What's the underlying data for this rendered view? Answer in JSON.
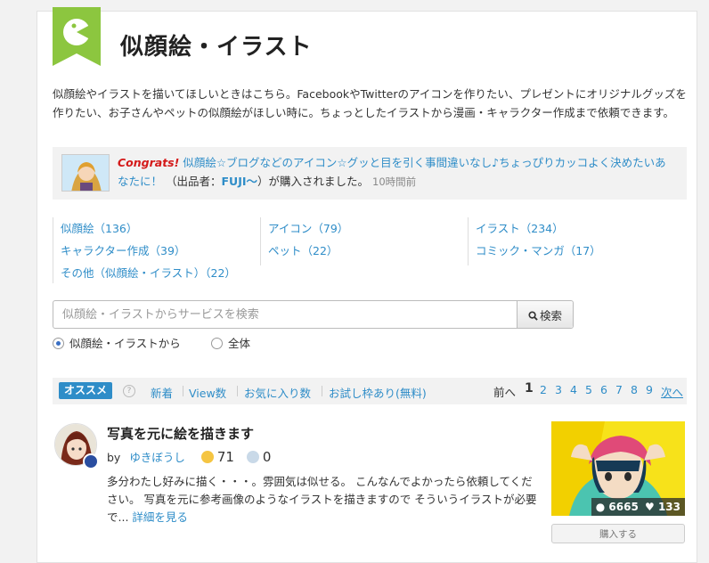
{
  "header": {
    "title": "似顔絵・イラスト"
  },
  "intro": "似顔絵やイラストを描いてほしいときはこちら。FacebookやTwitterのアイコンを作りたい、プレゼントにオリジナルグッズを作りたい、お子さんやペットの似顔絵がほしい時に。ちょっとしたイラストから漫画・キャラクター作成まで依頼できます。",
  "congrats": {
    "label": "Congrats!",
    "service": "似顔絵☆ブログなどのアイコン☆グッと目を引く事間違いなし♪ちょっぴりカッコよく決めたいあなたに！",
    "seller_prefix": "（出品者：",
    "seller": "FUJI〜",
    "seller_suffix": "）が購入されました。",
    "time": "10時間前"
  },
  "categories": {
    "col1": [
      "似顔絵（136）",
      "キャラクター作成（39）",
      "その他（似顔絵・イラスト）（22）"
    ],
    "col2": [
      "アイコン（79）",
      "ペット（22）"
    ],
    "col3": [
      "イラスト（234）",
      "コミック・マンガ（17）"
    ]
  },
  "search": {
    "placeholder": "似顔絵・イラストからサービスを検索",
    "button": "検索"
  },
  "scope": {
    "option1": "似顔絵・イラストから",
    "option2": "全体"
  },
  "sort": {
    "badge": "オススメ",
    "help": "?",
    "items": [
      "新着",
      "View数",
      "お気に入り数",
      "お試し枠あり(無料)"
    ]
  },
  "pager": {
    "prev": "前へ",
    "current": "1",
    "pages": [
      "2",
      "3",
      "4",
      "5",
      "6",
      "7",
      "8",
      "9"
    ],
    "next": "次へ"
  },
  "listing": {
    "title": "写真を元に絵を描きます",
    "by": "by",
    "seller": "ゆきぼうし",
    "good": "71",
    "bad": "0",
    "description": "多分わたし好みに描く・・・。雰囲気は似せる。 こんなんでよかったら依頼してください。 写真を元に参考画像のようなイラストを描きますので そういうイラストが必要で...",
    "more": "詳細を見る",
    "views": "6665",
    "likes": "133",
    "buy": "購入する"
  },
  "colors": {
    "accent": "#2f8dc8",
    "ribbon": "#8cc63f",
    "congrats": "#d41a1a"
  }
}
